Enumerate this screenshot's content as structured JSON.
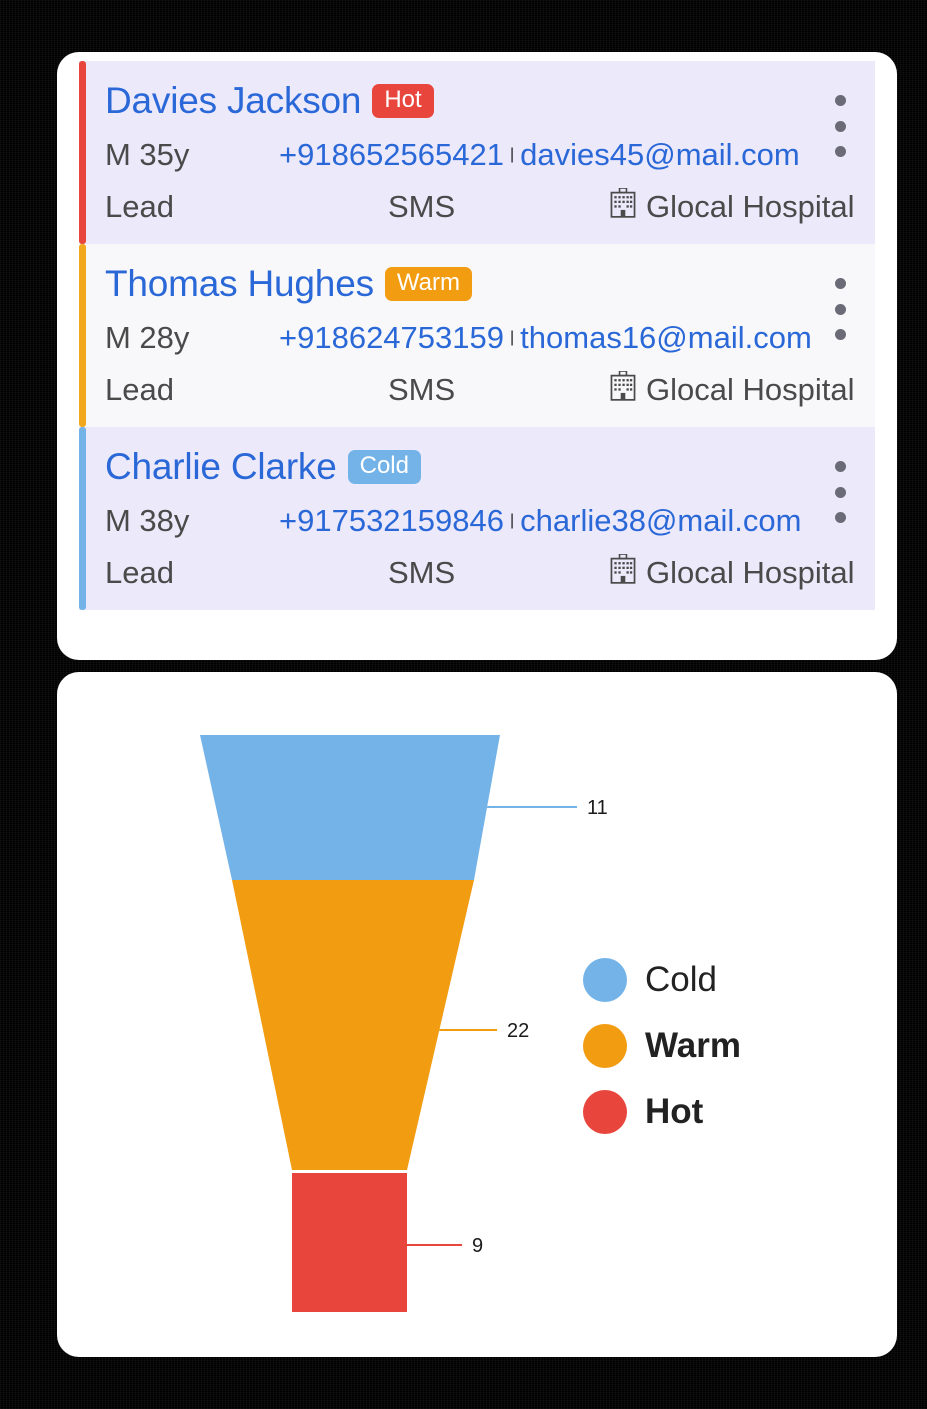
{
  "theme": {
    "background": "#000000",
    "panel_bg": "#ffffff",
    "name_link_color": "#2a68d8",
    "hot_color": "#e8453c",
    "warm_color": "#f29c11",
    "cold_color": "#74b3e8",
    "card_tint": "#ece9fb",
    "card_plain": "#f8f8fa"
  },
  "leads_panel": {
    "cards": [
      {
        "name": "Davies Jackson",
        "badge": "Hot",
        "badge_color": "#e8453c",
        "accent_color": "#e8453c",
        "row_bg": "#ece9fb",
        "age": "M 35y",
        "phone": "+918652565421",
        "separator": "|",
        "email": "davies45@mail.com",
        "stage": "Lead",
        "channel": "SMS",
        "hospital": "Glocal Hospital",
        "menu": "kebab-menu"
      },
      {
        "name": "Thomas Hughes",
        "badge": "Warm",
        "badge_color": "#f29c11",
        "accent_color": "#f2a81c",
        "row_bg": "#f8f8fa",
        "age": "M 28y",
        "phone": "+918624753159",
        "separator": "|",
        "email": "thomas16@mail.com",
        "stage": "Lead",
        "channel": "SMS",
        "hospital": "Glocal Hospital",
        "menu": "kebab-menu"
      },
      {
        "name": "Charlie Clarke",
        "badge": "Cold",
        "badge_color": "#74b3e8",
        "accent_color": "#74b3e8",
        "row_bg": "#ece9fb",
        "age": "M 38y",
        "phone": "+917532159846",
        "separator": "|",
        "email": "charlie38@mail.com",
        "stage": "Lead",
        "channel": "SMS",
        "hospital": "Glocal Hospital",
        "menu": "kebab-menu"
      }
    ]
  },
  "chart_data": {
    "type": "funnel",
    "title": "",
    "categories": [
      "Cold",
      "Warm",
      "Hot"
    ],
    "values": [
      11,
      22,
      9
    ],
    "labels": [
      "11",
      "22",
      "9"
    ],
    "colors": [
      "#74b3e8",
      "#f29c11",
      "#e8453c"
    ],
    "legend": [
      {
        "label": "Cold",
        "color": "#74b3e8"
      },
      {
        "label": "Warm",
        "color": "#f29c11"
      },
      {
        "label": "Hot",
        "color": "#e8453c"
      }
    ],
    "legend_position": "right",
    "grid": false
  }
}
